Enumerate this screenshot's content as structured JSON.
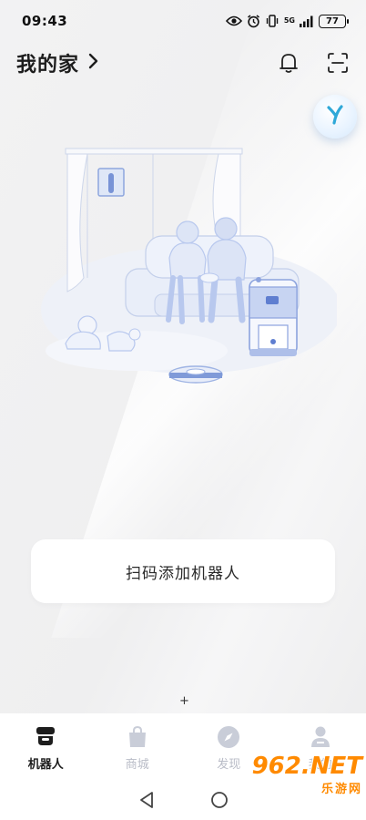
{
  "status_bar": {
    "time": "09:43",
    "network": "5G",
    "battery": "77",
    "icons": [
      "eye-icon",
      "alarm-icon",
      "vibrate-icon",
      "signal-icon",
      "battery-icon"
    ]
  },
  "header": {
    "title": "我的家",
    "icons": [
      "chevron-right-icon",
      "bell-icon",
      "scan-icon"
    ]
  },
  "assistant": {
    "icon": "assistant-logo-icon",
    "accent": "#2fa8d8"
  },
  "main": {
    "illustration": "robot-home-illustration",
    "add_card_label": "扫码添加机器人",
    "plus": "+"
  },
  "tabs": [
    {
      "label": "机器人",
      "icon": "robot-icon",
      "active": true
    },
    {
      "label": "商城",
      "icon": "shopping-bag-icon",
      "active": false
    },
    {
      "label": "发现",
      "icon": "compass-icon",
      "active": false
    },
    {
      "label": "我的",
      "icon": "person-icon",
      "active": false
    }
  ],
  "nav": {
    "icons": [
      "back-icon",
      "home-icon"
    ]
  },
  "watermark": {
    "main": "962.NET",
    "sub": "乐游网"
  },
  "colors": {
    "active_tab": "#1d1d1d",
    "inactive_tab": "#b9bcc7",
    "illustration_blue": "#b8c8ee",
    "watermark": "#ff8a00"
  }
}
